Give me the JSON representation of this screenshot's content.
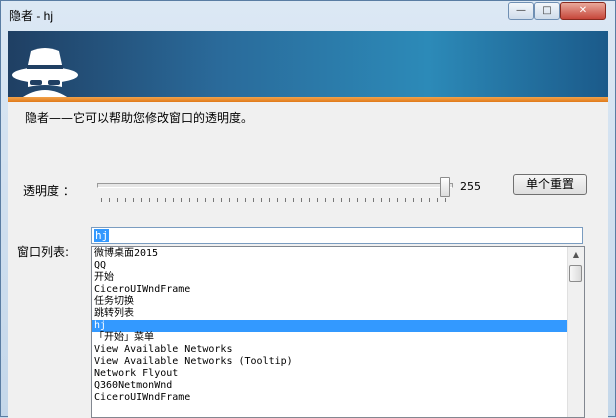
{
  "window": {
    "title": "隐者 - hj"
  },
  "controls": {
    "minimize": "—",
    "maximize": "□",
    "close": "✕"
  },
  "header": {
    "description": "隐者——它可以帮助您修改窗口的透明度。"
  },
  "opacity": {
    "label": "透明度 ：",
    "value": "255",
    "level_fraction": 0.98
  },
  "reset_button": {
    "label": "单个重置"
  },
  "window_list": {
    "label": "窗口列表:",
    "filter_value": "hj",
    "items": [
      "微博桌面2015",
      "QQ",
      "开始",
      "CiceroUIWndFrame",
      "任务切换",
      "跳转列表",
      "hj",
      "「开始」菜单",
      "View Available Networks",
      "View Available Networks (Tooltip)",
      "Network Flyout",
      "Q360NetmonWnd",
      "CiceroUIWndFrame"
    ],
    "selected_index": 6
  },
  "colors": {
    "selection": "#3399ff",
    "accent_orange": "#e07a1a",
    "banner": "#2a6a9a"
  }
}
